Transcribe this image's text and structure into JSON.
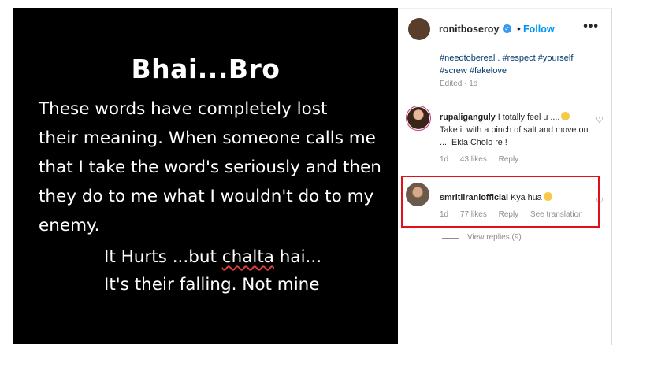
{
  "post": {
    "heading": "Bhai...Bro",
    "paragraph_lines": [
      "These words have completely lost",
      "their meaning. When someone calls me",
      "that I take the word's seriously and then",
      "they do to me what I wouldn't do to my",
      "enemy."
    ],
    "tail_line1_prefix": "It Hurts ...but ",
    "tail_line1_misspelled": "chalta",
    "tail_line1_suffix": " hai...",
    "tail_line2": "It's their falling. Not mine"
  },
  "header": {
    "username": "ronitboseroy",
    "separator": "•",
    "follow_label": "Follow",
    "more_label": "•••"
  },
  "caption": {
    "hashtags": "#needtobereal . #respect #yourself #screw #fakelove",
    "edited": "Edited · 1d"
  },
  "comments": [
    {
      "username": "rupaliganguly",
      "text": "I totally feel u ....",
      "text_cont": "Take it with a pinch of salt and move on .... Ekla Cholo re !",
      "time": "1d",
      "likes": "43 likes",
      "reply_label": "Reply"
    },
    {
      "username": "smritiiraniofficial",
      "text": "Kya hua",
      "time": "1d",
      "likes": "77 likes",
      "reply_label": "Reply",
      "translation_label": "See translation",
      "view_replies": "View replies (9)"
    }
  ],
  "icons": {
    "heart": "heart-icon",
    "verified": "verified-badge-icon"
  },
  "colors": {
    "link_blue": "#0095f6",
    "highlight_red": "#e0111b",
    "hashtag_blue": "#00376b"
  }
}
